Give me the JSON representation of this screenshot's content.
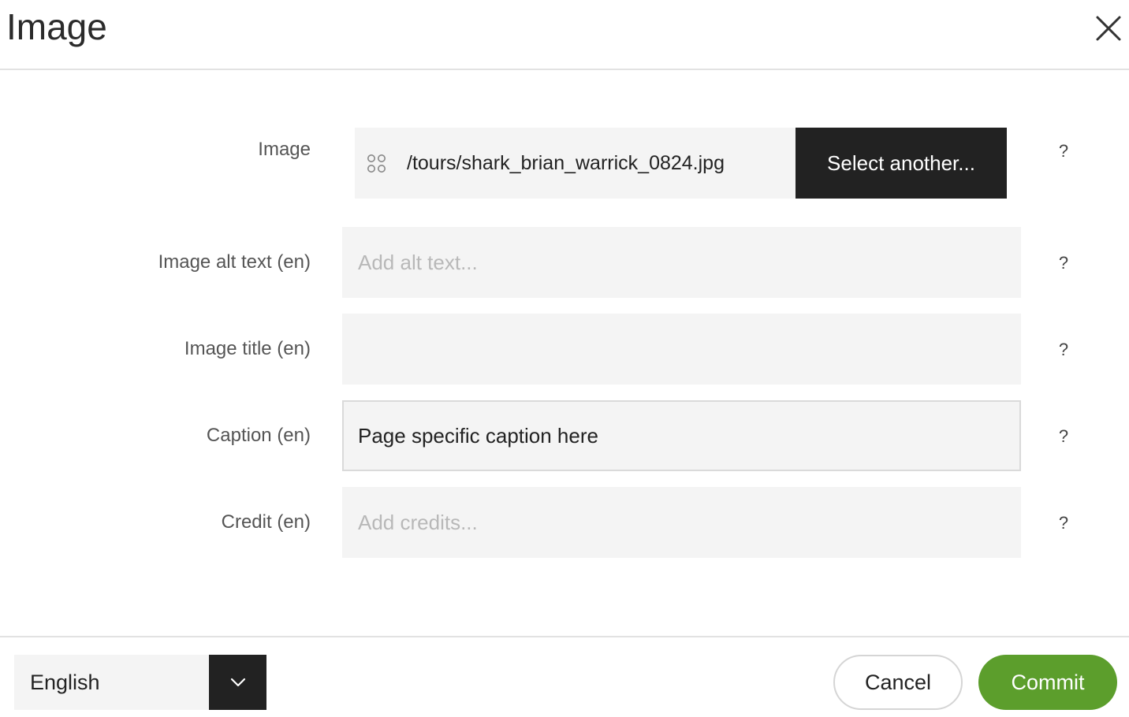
{
  "dialog": {
    "title": "Image",
    "close_icon": "close-icon"
  },
  "fields": {
    "image": {
      "label": "Image",
      "value": "/tours/shark_brian_warrick_0824.jpg",
      "icon": "drag-handle-icon",
      "select_label": "Select another...",
      "help": "?"
    },
    "alt_text": {
      "label": "Image alt text (en)",
      "value": "",
      "placeholder": "Add alt text...",
      "help": "?"
    },
    "title": {
      "label": "Image title (en)",
      "value": "",
      "placeholder": "",
      "help": "?"
    },
    "caption": {
      "label": "Caption (en)",
      "value": "Page specific caption here",
      "placeholder": "",
      "help": "?"
    },
    "credit": {
      "label": "Credit (en)",
      "value": "",
      "placeholder": "Add credits...",
      "help": "?"
    }
  },
  "footer": {
    "language": {
      "selected": "English",
      "icon": "chevron-down-icon"
    },
    "cancel_label": "Cancel",
    "commit_label": "Commit"
  },
  "colors": {
    "primary_dark": "#222222",
    "commit_green": "#5c9e2c",
    "field_background": "#f4f4f4",
    "divider": "#e2e2e2"
  }
}
